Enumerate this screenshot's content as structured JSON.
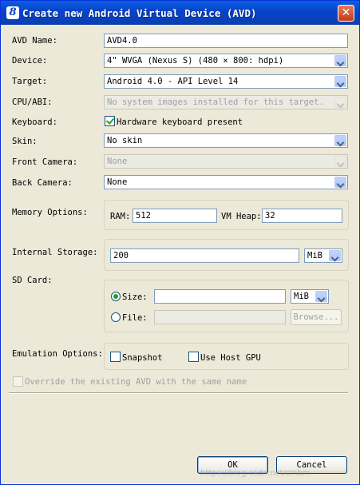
{
  "window": {
    "title": "Create new Android Virtual Device (AVD)",
    "icon_glyph": "8",
    "close_glyph": "✕"
  },
  "form": {
    "avd_name": {
      "label": "AVD Name:",
      "value": "AVD4.0"
    },
    "device": {
      "label": "Device:",
      "value": "4\" WVGA (Nexus S) (480 × 800: hdpi)"
    },
    "target": {
      "label": "Target:",
      "value": "Android 4.0 - API Level 14"
    },
    "cpu_abi": {
      "label": "CPU/ABI:",
      "value": "No system images installed for this target."
    },
    "keyboard": {
      "label": "Keyboard:",
      "checkbox_label": "Hardware keyboard present",
      "checked": true
    },
    "skin": {
      "label": "Skin:",
      "value": "No skin"
    },
    "front_camera": {
      "label": "Front Camera:",
      "value": "None"
    },
    "back_camera": {
      "label": "Back Camera:",
      "value": "None"
    },
    "memory": {
      "label": "Memory Options:",
      "ram_label": "RAM:",
      "ram_value": "512",
      "vm_heap_label": "VM Heap:",
      "vm_heap_value": "32"
    },
    "internal_storage": {
      "label": "Internal Storage:",
      "value": "200",
      "unit": "MiB"
    },
    "sd_card": {
      "label": "SD Card:",
      "size_label": "Size:",
      "size_value": "",
      "size_unit": "MiB",
      "file_label": "File:",
      "file_value": "",
      "browse_label": "Browse..."
    },
    "emulation": {
      "label": "Emulation Options:",
      "snapshot_label": "Snapshot",
      "gpu_label": "Use Host GPU"
    },
    "override": {
      "label": "Override the existing AVD with the same name"
    }
  },
  "buttons": {
    "ok": "OK",
    "cancel": "Cancel"
  },
  "watermark": "https://blog.csdn.net/clnbm"
}
